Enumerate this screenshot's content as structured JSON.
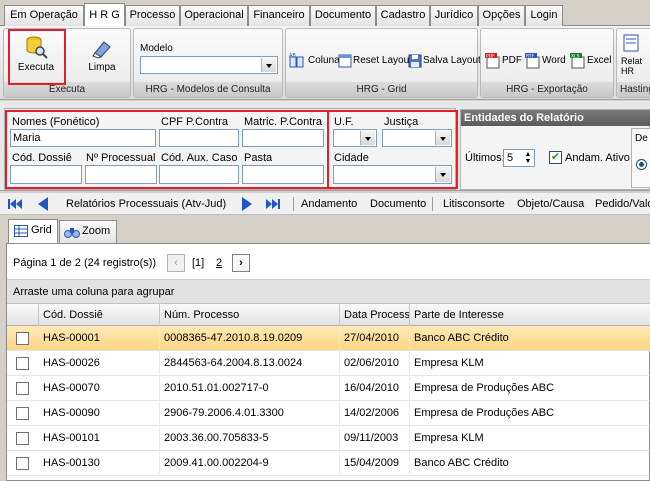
{
  "tabs": [
    "Em Operação",
    "H R G",
    "Processo",
    "Operacional",
    "Financeiro",
    "Documento",
    "Cadastro",
    "Jurídico",
    "Opções",
    "Login"
  ],
  "ribbon": {
    "executa": "Executa",
    "limpa": "Limpa",
    "grp_executa": "Executa",
    "modelo_label": "Modelo",
    "grp_modelos": "HRG - Modelos de Consulta",
    "coluna": "Coluna",
    "reset": "Reset Layout",
    "salva": "Salva Layout",
    "grp_grid": "HRG - Grid",
    "pdf": "PDF",
    "word": "Word",
    "excel": "Excel",
    "grp_export": "HRG - Exportação",
    "hasting": "Hasting",
    "relat": "Relat",
    "hrg2": "HR"
  },
  "filters": {
    "nomes_label": "Nomes (Fonético)",
    "nomes_value": "Maria",
    "cpf_label": "CPF P.Contra",
    "matric_label": "Matric. P.Contra",
    "cod_dossie_label": "Cód. Dossiê",
    "num_proc_label": "Nº Processual",
    "cod_aux_label": "Cód. Aux. Caso",
    "pasta_label": "Pasta",
    "uf_label": "U.F.",
    "justica_label": "Justiça",
    "cidade_label": "Cidade"
  },
  "entidades": {
    "title": "Entidades do Relatório",
    "ultimos_label": "Últimos:",
    "ultimos_value": "5",
    "andam_label": "Andam. Ativo",
    "de": "De"
  },
  "nav": {
    "title": "Relatórios Processuais (Atv-Jud)",
    "items": [
      "Andamento",
      "Documento",
      "Litisconsorte",
      "Objeto/Causa",
      "Pedido/Valo"
    ]
  },
  "gridtabs": {
    "grid": "Grid",
    "zoom": "Zoom"
  },
  "pager": {
    "info": "Página 1 de 2 (24 registro(s))",
    "page1": "[1]",
    "page2": "2"
  },
  "groupbar": "Arraste uma coluna para agrupar",
  "columns": [
    "Cód. Dossiê",
    "Núm. Processo",
    "Data Process",
    "Parte de Interesse"
  ],
  "rows": [
    [
      "HAS-00001",
      "0008365-47.2010.8.19.0209",
      "27/04/2010",
      "Banco ABC Crédito"
    ],
    [
      "HAS-00026",
      "2844563-64.2004.8.13.0024",
      "02/06/2010",
      "Empresa KLM"
    ],
    [
      "HAS-00070",
      "2010.51.01.002717-0",
      "16/04/2010",
      "Empresa de Produções ABC"
    ],
    [
      "HAS-00090",
      "2906-79.2006.4.01.3300",
      "14/02/2006",
      "Empresa de Produções ABC"
    ],
    [
      "HAS-00101",
      "2003.36.00.705833-5",
      "09/11/2003",
      "Empresa KLM"
    ],
    [
      "HAS-00130",
      "2009.41.00.002204-9",
      "15/04/2009",
      "Banco ABC Crédito"
    ]
  ],
  "colors": {
    "highlight": "#e0202a",
    "selected_row": "#fcd583",
    "nav_blue": "#1f57c7"
  }
}
